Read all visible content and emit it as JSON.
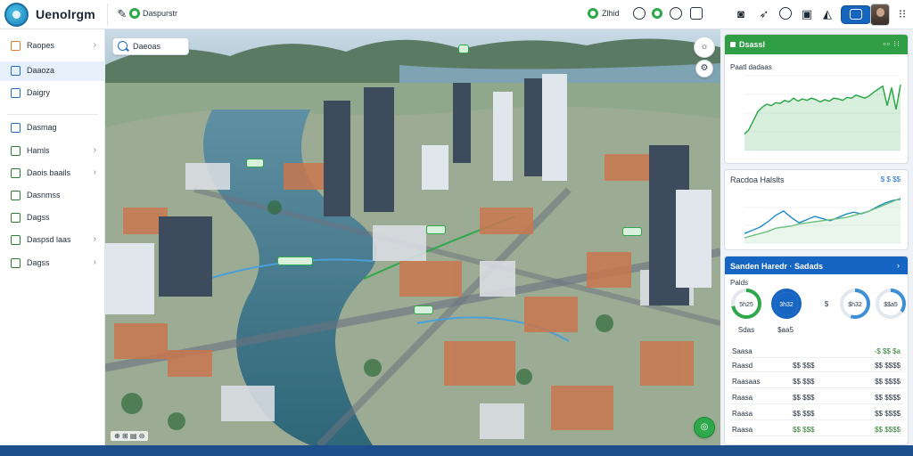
{
  "app": {
    "brand": "Uenolrgm"
  },
  "topbar": {
    "breadcrumb_text": "Daspurstr",
    "status_text": "Zlhid",
    "colors": {
      "accent": "#1565c0",
      "ok": "#2ea84a"
    }
  },
  "sidebar": {
    "items": [
      {
        "label": "Raopes",
        "icon": "layers-icon",
        "chevron": "›"
      },
      {
        "label": "Daaoza",
        "icon": "map-pin-icon",
        "chevron": ""
      },
      {
        "label": "Daigry",
        "icon": "grid-icon",
        "chevron": ""
      },
      {
        "label": "Dasmag",
        "icon": "check-icon",
        "chevron": ""
      },
      {
        "label": "Hamls",
        "icon": "list-icon",
        "chevron": "›"
      },
      {
        "label": "Daois baails",
        "icon": "box-icon",
        "chevron": "›"
      },
      {
        "label": "Dasnmss",
        "icon": "check-icon",
        "chevron": ""
      },
      {
        "label": "Dagss",
        "icon": "check-icon",
        "chevron": ""
      },
      {
        "label": "Daspsd laas",
        "icon": "list-icon",
        "chevron": "›"
      },
      {
        "label": "Dagss",
        "icon": "check-icon",
        "chevron": "›"
      }
    ]
  },
  "map": {
    "search_label": "Daeoas",
    "footer": "⊕ ⊞ ▤ ⊖"
  },
  "panel_traffic": {
    "title": "Dsassl",
    "header_right": "▫▫ ⁝⁝",
    "subtitle": "Paatl dadaas",
    "chart_data": {
      "type": "area",
      "x": [
        0,
        1,
        2,
        3,
        4,
        5,
        6,
        7,
        8,
        9,
        10,
        11,
        12,
        13,
        14,
        15,
        16,
        17,
        18,
        19,
        20,
        21,
        22,
        23,
        24,
        25,
        26,
        27,
        28,
        29,
        30,
        31,
        32,
        33,
        34,
        35
      ],
      "values": [
        22,
        28,
        40,
        52,
        58,
        62,
        60,
        64,
        63,
        67,
        65,
        70,
        66,
        69,
        67,
        70,
        68,
        65,
        68,
        66,
        70,
        69,
        67,
        71,
        70,
        74,
        72,
        70,
        73,
        78,
        82,
        86,
        60,
        84,
        55,
        88
      ],
      "ylim": [
        0,
        100
      ],
      "color": "#2ea84a"
    }
  },
  "panel_flow": {
    "title": "Racdoa Halslts",
    "header_right": "$ $ $$",
    "chart_data": {
      "type": "line",
      "x": [
        0,
        1,
        2,
        3,
        4,
        5,
        6,
        7,
        8,
        9,
        10,
        11,
        12,
        13,
        14,
        15,
        16,
        17,
        18,
        19,
        20
      ],
      "series": [
        {
          "values": [
            18,
            24,
            30,
            40,
            52,
            60,
            48,
            38,
            44,
            50,
            46,
            42,
            48,
            54,
            58,
            55,
            60,
            68,
            75,
            80,
            82
          ],
          "color": "#1e88c8"
        },
        {
          "values": [
            10,
            14,
            18,
            22,
            28,
            30,
            32,
            36,
            38,
            40,
            42,
            44,
            46,
            48,
            52,
            56,
            60,
            66,
            72,
            78,
            84
          ],
          "color": "#6cc080"
        }
      ],
      "ylim": [
        0,
        100
      ]
    }
  },
  "panel_stats": {
    "title": "Sanden Haredr · Sadads",
    "chevron": "›",
    "subtitle": "Palds",
    "donuts": [
      {
        "label": "Sdas",
        "center": "5h25",
        "fraction": 0.72,
        "color": "#2ea84a"
      },
      {
        "label": "$aa5",
        "center": "3h32",
        "fraction": 1.0,
        "color": "#1665c2"
      },
      {
        "label": "",
        "center": "$",
        "fraction": 0.0,
        "color": "#9aa7b4"
      },
      {
        "label": "",
        "center": "$h32",
        "fraction": 0.55,
        "color": "#3f8fd6"
      },
      {
        "label": "",
        "center": "$$a5",
        "fraction": 0.35,
        "color": "#3f8fd6"
      }
    ],
    "rows": [
      {
        "name": "Saasa",
        "mid": "",
        "right": "-$  $$  $a"
      },
      {
        "name": "Raasd",
        "mid": "$$ $$$",
        "right": "$$ $$$$"
      },
      {
        "name": "Raasaas",
        "mid": "$$ $$$",
        "right": "$$ $$$$"
      },
      {
        "name": "Raasa",
        "mid": "$$ $$$",
        "right": "$$ $$$$"
      },
      {
        "name": "Raasa",
        "mid": "$$ $$$",
        "right": "$$ $$$$"
      },
      {
        "name": "Raasa",
        "mid": "$$ $$$",
        "right": "$$ $$$$"
      }
    ]
  }
}
